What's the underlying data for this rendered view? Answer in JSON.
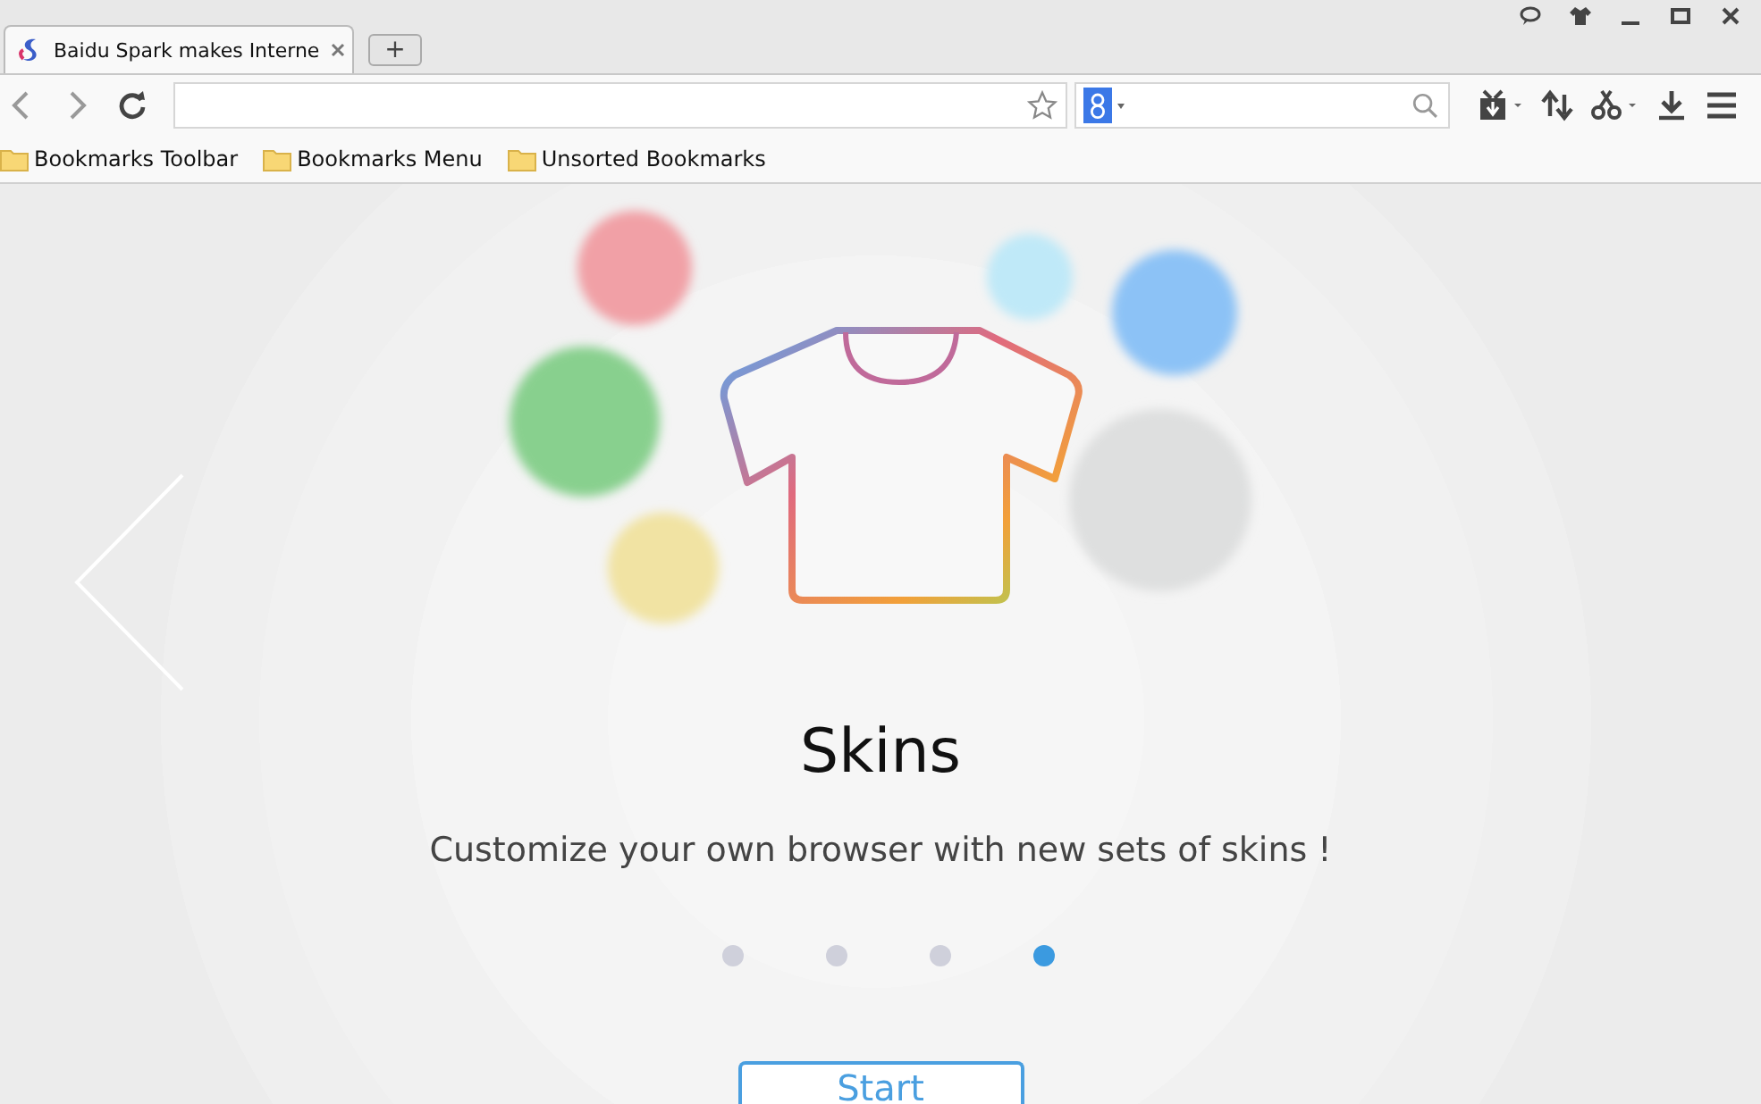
{
  "tabs": [
    {
      "title": "Baidu Spark makes Interne",
      "selected": true
    }
  ],
  "new_tab": "+",
  "bookmarks": [
    {
      "label": "Bookmarks Toolbar"
    },
    {
      "label": "Bookmarks Menu"
    },
    {
      "label": "Unsorted Bookmarks"
    }
  ],
  "slide": {
    "title": "Skins",
    "subtitle": "Customize your own browser with new sets of skins !"
  },
  "pager": [
    {
      "selected": false
    },
    {
      "selected": false
    },
    {
      "selected": false
    },
    {
      "selected": true
    }
  ],
  "start_button": "Start"
}
